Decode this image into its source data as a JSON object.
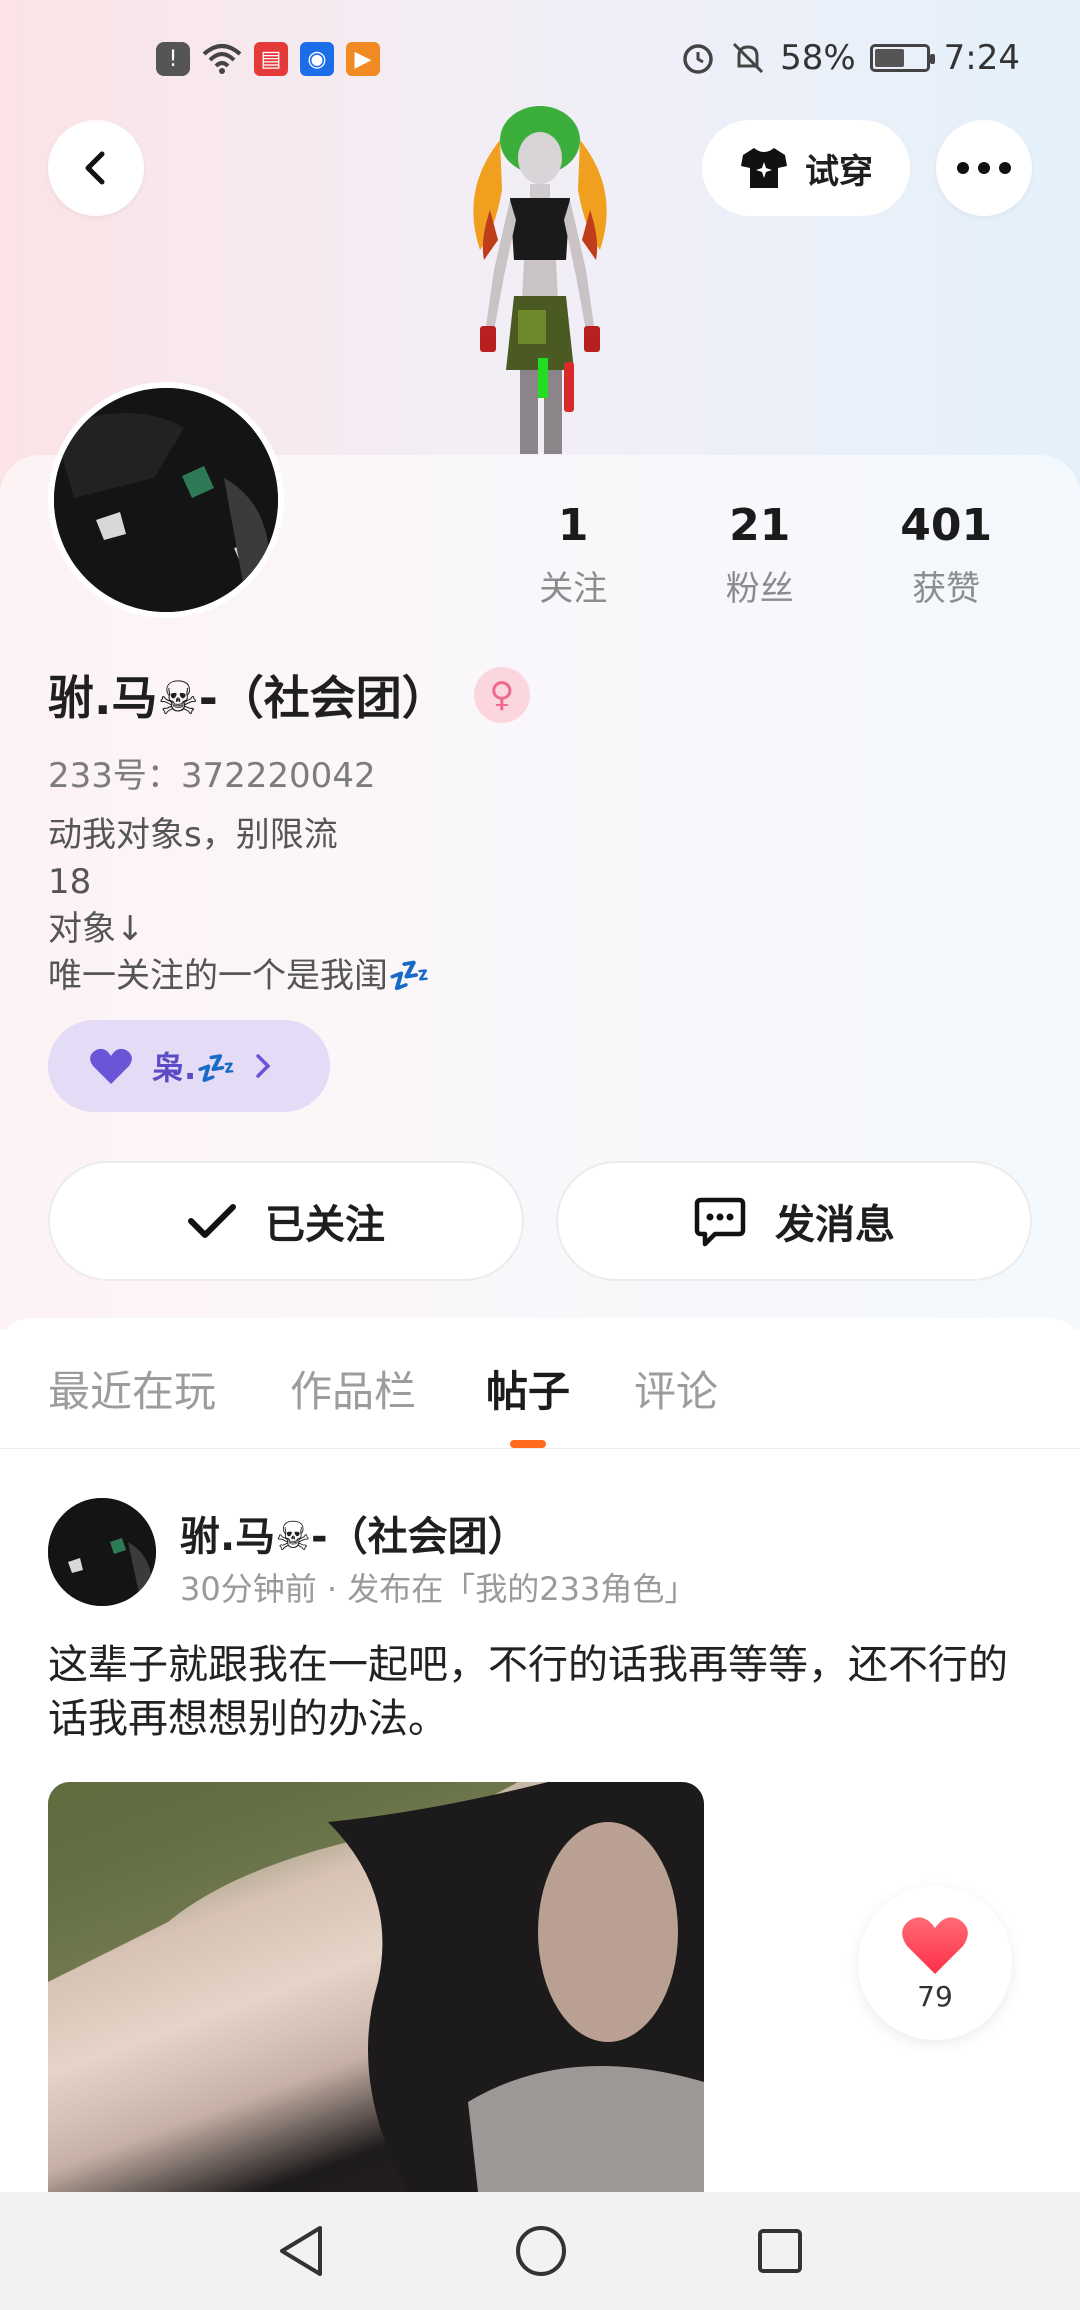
{
  "status_bar": {
    "battery": "58%",
    "battery_level": 0.58,
    "time": "7:24",
    "left_icons": [
      "alert-icon",
      "wifi-icon",
      "book-app-icon",
      "bulb-app-icon",
      "video-app-icon"
    ],
    "right_icons": [
      "alarm-icon",
      "mute-icon",
      "battery-icon"
    ]
  },
  "header": {
    "back_icon": "chevron-left-icon",
    "try_on_label": "试穿",
    "more_icon": "more-dots-icon"
  },
  "profile": {
    "stats": [
      {
        "num": "1",
        "label": "关注"
      },
      {
        "num": "21",
        "label": "粉丝"
      },
      {
        "num": "401",
        "label": "获赞"
      }
    ],
    "name": "驸.马☠-（社会团）",
    "gender_icon": "female-icon",
    "uid": "233号：372220042",
    "bio": [
      "动我对象s，别限流",
      "18",
      "对象↓",
      "唯一关注的一个是我闺💤"
    ],
    "relation_chip": {
      "label": "枭.💤",
      "icon": "heart-icon"
    },
    "follow_button": "已关注",
    "message_button": "发消息"
  },
  "tabs": [
    {
      "label": "最近在玩",
      "active": false
    },
    {
      "label": "作品栏",
      "active": false
    },
    {
      "label": "帖子",
      "active": true
    },
    {
      "label": "评论",
      "active": false
    }
  ],
  "post": {
    "author": "驸.马☠-（社会团）",
    "meta": "30分钟前 · 发布在「我的233角色」",
    "text": "这辈子就跟我在一起吧，不行的话我再等等，还不行的话我再想想别的办法。",
    "likes": "79"
  },
  "colors": {
    "accent": "#ff6b1a",
    "chip_bg": "#e4dcf6",
    "chip_text": "#5c4cc4",
    "like_heart": "#ff4d5e"
  }
}
